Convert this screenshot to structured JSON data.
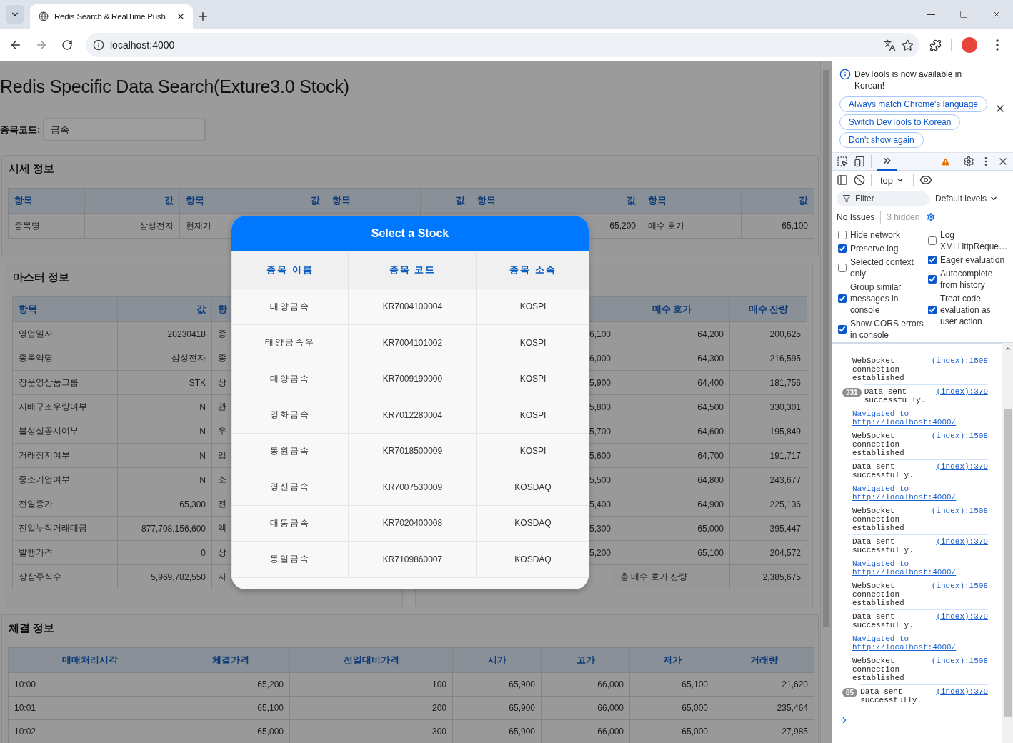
{
  "browser": {
    "tab_title": "Redis Search & RealTime Push",
    "address": "localhost:4000"
  },
  "page": {
    "title": "Redis Specific Data Search(Exture3.0 Stock)",
    "search": {
      "label": "종목코드:",
      "value": "금속"
    },
    "price_info": {
      "title": "시세 정보",
      "columns": [
        "항목",
        "값",
        "항목",
        "값",
        "항목",
        "값",
        "항목",
        "값",
        "항목",
        "값"
      ],
      "rows": [
        [
          "종목명",
          "삼성전자",
          "현재가",
          null,
          null,
          null,
          null,
          "65,200",
          "매수 호가",
          "65,100"
        ]
      ]
    },
    "master_info": {
      "title": "마스터 정보",
      "columns": [
        "항목",
        "값",
        "항",
        null
      ],
      "rows": [
        [
          "영업일자",
          "20230418",
          "종",
          null
        ],
        [
          "종목약명",
          "삼성전자",
          "종",
          null
        ],
        [
          "장운영상품그룹",
          "STK",
          "상",
          null
        ],
        [
          "지배구조우량여부",
          "N",
          "관",
          null
        ],
        [
          "불성실공시여부",
          "N",
          "우",
          null
        ],
        [
          "거래정지여부",
          "N",
          "업",
          null
        ],
        [
          "중소기업여부",
          "N",
          "소",
          null
        ],
        [
          "전일종가",
          "65,300",
          "전",
          null
        ],
        [
          "전일누적거래대금",
          "877,708,156,600",
          "액",
          null
        ],
        [
          "발행가격",
          "0",
          "상",
          null
        ],
        [
          "상장주식수",
          "5,969,782,550",
          "자",
          null
        ]
      ]
    },
    "order_book": {
      "columns": [
        null,
        null,
        "매수 호가",
        "매수 잔량"
      ],
      "rows": [
        {
          "kind": "level",
          "cells": [
            null,
            "6,100",
            "64,200",
            "200,625"
          ]
        },
        {
          "kind": "level",
          "cells": [
            null,
            "6,000",
            "64,300",
            "216,595"
          ]
        },
        {
          "kind": "level",
          "cells": [
            null,
            "5,900",
            "64,400",
            "181,756"
          ]
        },
        {
          "kind": "level",
          "cells": [
            null,
            "5,800",
            "64,500",
            "330,301"
          ]
        },
        {
          "kind": "level",
          "cells": [
            null,
            "5,700",
            "64,600",
            "195,849"
          ]
        },
        {
          "kind": "level",
          "cells": [
            null,
            "5,600",
            "64,700",
            "191,717"
          ]
        },
        {
          "kind": "level",
          "cells": [
            null,
            "5,500",
            "64,800",
            "243,677"
          ]
        },
        {
          "kind": "level",
          "cells": [
            null,
            "5,400",
            "64,900",
            "225,136"
          ]
        },
        {
          "kind": "level",
          "cells": [
            null,
            "5,300",
            "65,000",
            "395,447"
          ]
        },
        {
          "kind": "level",
          "cells": [
            null,
            "5,200",
            "65,100",
            "204,572"
          ]
        },
        {
          "kind": "total",
          "cells": [
            null,
            null,
            "총 매수 호가 잔량",
            "2,385,675"
          ]
        }
      ]
    },
    "trades": {
      "title": "체결 정보",
      "columns": [
        "매매처리시각",
        "체결가격",
        "전일대비가격",
        "시가",
        "고가",
        "저가",
        "거래량"
      ],
      "rows": [
        [
          "10:00",
          "65,200",
          "100",
          "65,900",
          "66,000",
          "65,100",
          "21,620"
        ],
        [
          "10:01",
          "65,100",
          "200",
          "65,900",
          "66,000",
          "65,000",
          "235,464"
        ],
        [
          "10:02",
          "65,000",
          "300",
          "65,900",
          "66,000",
          "65,000",
          "27,985"
        ]
      ]
    }
  },
  "modal": {
    "title": "Select a Stock",
    "columns": [
      "종목 이름",
      "종목 코드",
      "종목 소속"
    ],
    "rows": [
      [
        "태양금속",
        "KR7004100004",
        "KOSPI"
      ],
      [
        "태양금속우",
        "KR7004101002",
        "KOSPI"
      ],
      [
        "대양금속",
        "KR7009190000",
        "KOSPI"
      ],
      [
        "영화금속",
        "KR7012280004",
        "KOSPI"
      ],
      [
        "동원금속",
        "KR7018500009",
        "KOSPI"
      ],
      [
        "영신금속",
        "KR7007530009",
        "KOSDAQ"
      ],
      [
        "대동금속",
        "KR7020400008",
        "KOSDAQ"
      ],
      [
        "동일금속",
        "KR7109860007",
        "KOSDAQ"
      ]
    ]
  },
  "devtools": {
    "banner": {
      "message": "DevTools is now available in Korean!",
      "buttons": [
        "Always match Chrome's language",
        "Switch DevTools to Korean",
        "Don't show again"
      ]
    },
    "context": "top",
    "filter": {
      "placeholder": "Filter"
    },
    "levels": "Default levels",
    "issues": "No Issues",
    "hidden": "3 hidden",
    "settings_left": [
      {
        "label": "Hide network",
        "checked": false
      },
      {
        "label": "Preserve log",
        "checked": true
      },
      {
        "label": "Selected context only",
        "checked": false
      },
      {
        "label": "Group similar messages in console",
        "checked": true
      },
      {
        "label": "Show CORS errors in console",
        "checked": true
      }
    ],
    "settings_right": [
      {
        "label": "Log XMLHttpReque…",
        "checked": false
      },
      {
        "label": "Eager evaluation",
        "checked": true
      },
      {
        "label": "Autocomplete from history",
        "checked": true
      },
      {
        "label": "Treat code evaluation as user action",
        "checked": true
      }
    ],
    "messages": [
      {
        "kind": "log",
        "text": "WebSocket connection established",
        "source": "(index):1508"
      },
      {
        "kind": "log",
        "count": "331",
        "text": "Data sent successfully.",
        "source": "(index):379"
      },
      {
        "kind": "nav",
        "text": "Navigated to",
        "url": "http://localhost:4000/"
      },
      {
        "kind": "log",
        "text": "WebSocket connection established",
        "source": "(index):1508"
      },
      {
        "kind": "log",
        "text": "Data sent successfully.",
        "source": "(index):379"
      },
      {
        "kind": "nav",
        "text": "Navigated to",
        "url": "http://localhost:4000/"
      },
      {
        "kind": "log",
        "text": "WebSocket connection established",
        "source": "(index):1508"
      },
      {
        "kind": "log",
        "text": "Data sent successfully.",
        "source": "(index):379"
      },
      {
        "kind": "nav",
        "text": "Navigated to",
        "url": "http://localhost:4000/"
      },
      {
        "kind": "log",
        "text": "WebSocket connection established",
        "source": "(index):1508"
      },
      {
        "kind": "log",
        "text": "Data sent successfully.",
        "source": "(index):379"
      },
      {
        "kind": "nav",
        "text": "Navigated to",
        "url": "http://localhost:4000/"
      },
      {
        "kind": "log",
        "text": "WebSocket connection established",
        "source": "(index):1508"
      },
      {
        "kind": "log",
        "count": "85",
        "text": "Data sent successfully.",
        "source": "(index):379"
      }
    ]
  }
}
